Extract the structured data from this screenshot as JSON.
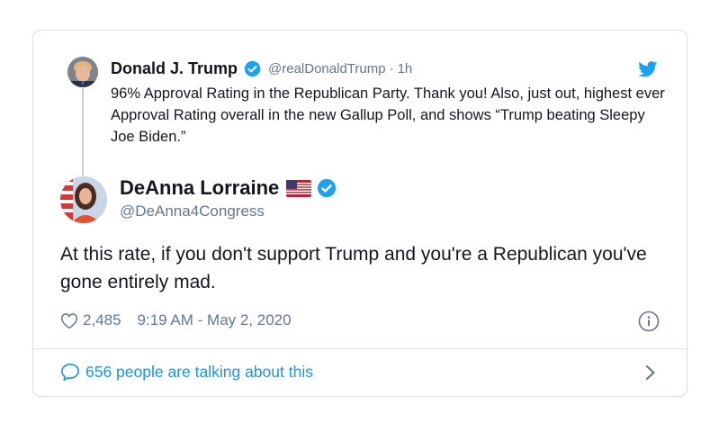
{
  "parent_tweet": {
    "author_name": "Donald J. Trump",
    "handle": "@realDonaldTrump",
    "separator": "·",
    "time_ago": "1h",
    "text": "96% Approval Rating in the Republican Party. Thank you! Also, just out, highest ever Approval Rating overall in the new Gallup Poll, and shows “Trump beating Sleepy Joe Biden.”"
  },
  "tweet": {
    "author_name": "DeAnna Lorraine",
    "handle": "@DeAnna4Congress",
    "text": "At this rate, if you don't support Trump and you're a Republican you've gone entirely mad.",
    "likes": "2,485",
    "timestamp": "9:19 AM - May 2, 2020"
  },
  "footer": {
    "conversation_text": "656 people are talking about this"
  },
  "icons": {
    "verified": "verified-badge-icon",
    "brand": "twitter-bird-icon",
    "flag": "us-flag-icon",
    "like": "heart-icon",
    "info": "info-icon",
    "reply": "speech-bubble-icon",
    "chevron": "chevron-right-icon"
  },
  "colors": {
    "accent": "#1da1f2",
    "link": "#1b95e0",
    "secondary_text": "#657786",
    "primary_text": "#14171a",
    "border": "#d9dfe4"
  }
}
